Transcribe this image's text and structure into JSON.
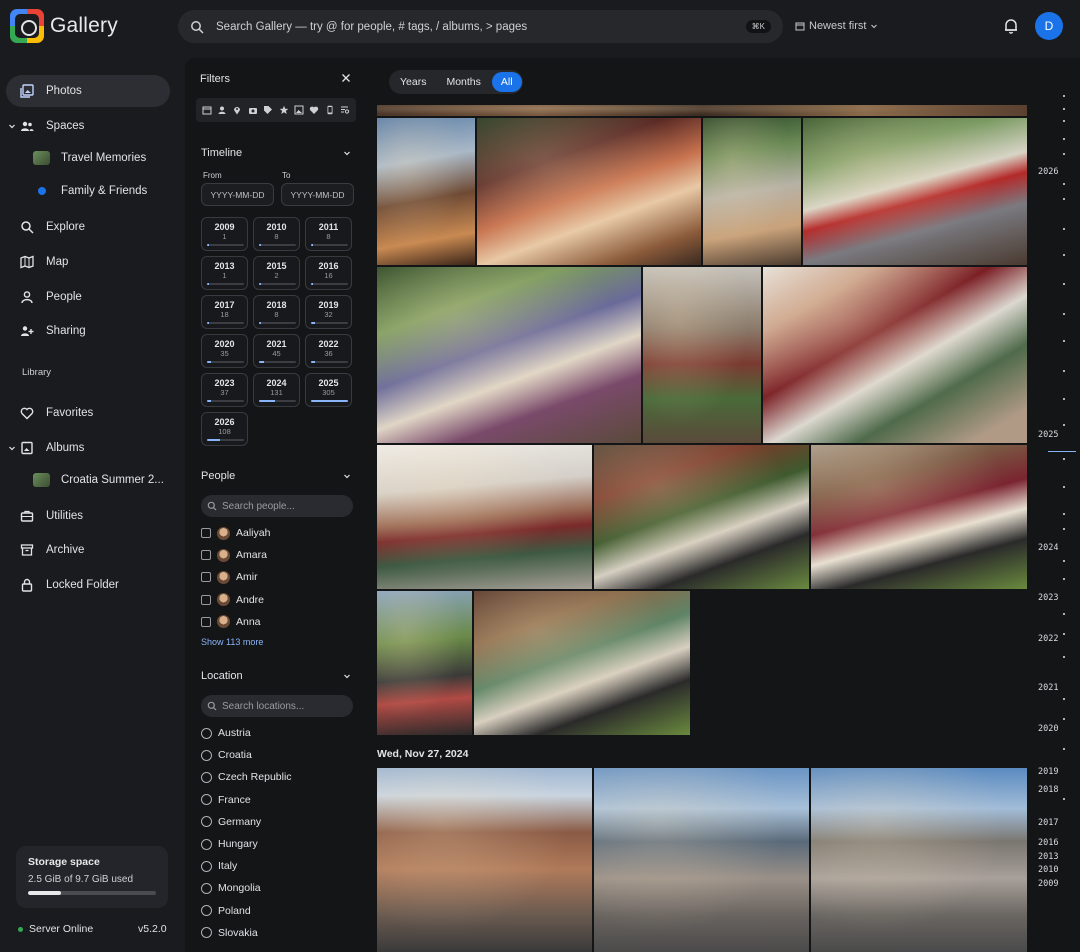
{
  "app": {
    "name": "Gallery"
  },
  "header": {
    "search_placeholder": "Search Gallery — try @ for people, # tags, / albums, > pages",
    "search_shortcut": "⌘K",
    "sort_label": "Newest first",
    "avatar_letter": "D"
  },
  "sidebar": {
    "items": [
      {
        "label": "Photos",
        "icon": "photos-icon",
        "active": true
      },
      {
        "label": "Spaces",
        "icon": "people-group-icon"
      },
      {
        "label": "Travel Memories",
        "icon": "thumbnail"
      },
      {
        "label": "Family & Friends",
        "icon": "blue-dot"
      },
      {
        "label": "Explore",
        "icon": "search-icon"
      },
      {
        "label": "Map",
        "icon": "map-icon"
      },
      {
        "label": "People",
        "icon": "person-icon"
      },
      {
        "label": "Sharing",
        "icon": "sharing-icon"
      },
      {
        "label": "Favorites",
        "icon": "heart-icon"
      },
      {
        "label": "Albums",
        "icon": "album-icon"
      },
      {
        "label": "Croatia Summer 2...",
        "icon": "thumbnail"
      },
      {
        "label": "Utilities",
        "icon": "utilities-icon"
      },
      {
        "label": "Archive",
        "icon": "archive-icon"
      },
      {
        "label": "Locked Folder",
        "icon": "lock-icon"
      }
    ],
    "library_label": "Library",
    "storage": {
      "title": "Storage space",
      "text": "2.5 GiB of 9.7 GiB used",
      "fraction": 0.26
    },
    "server_status": "Server Online",
    "version": "v5.2.0"
  },
  "filters": {
    "title": "Filters",
    "timeline": {
      "title": "Timeline",
      "from_label": "From",
      "to_label": "To",
      "from_placeholder": "YYYY-MM-DD",
      "to_placeholder": "YYYY-MM-DD",
      "years": [
        {
          "year": "2009",
          "count": "1"
        },
        {
          "year": "2010",
          "count": "8"
        },
        {
          "year": "2011",
          "count": "8"
        },
        {
          "year": "2013",
          "count": "1"
        },
        {
          "year": "2015",
          "count": "2"
        },
        {
          "year": "2016",
          "count": "16"
        },
        {
          "year": "2017",
          "count": "18"
        },
        {
          "year": "2018",
          "count": "8"
        },
        {
          "year": "2019",
          "count": "32"
        },
        {
          "year": "2020",
          "count": "35"
        },
        {
          "year": "2021",
          "count": "45"
        },
        {
          "year": "2022",
          "count": "36"
        },
        {
          "year": "2023",
          "count": "37"
        },
        {
          "year": "2024",
          "count": "131"
        },
        {
          "year": "2025",
          "count": "305"
        },
        {
          "year": "2026",
          "count": "108"
        }
      ]
    },
    "people": {
      "title": "People",
      "search_placeholder": "Search people...",
      "items": [
        "Aaliyah",
        "Amara",
        "Amir",
        "Andre",
        "Anna"
      ],
      "show_more": "Show 113 more"
    },
    "location": {
      "title": "Location",
      "search_placeholder": "Search locations...",
      "items": [
        "Austria",
        "Croatia",
        "Czech Republic",
        "France",
        "Germany",
        "Hungary",
        "Italy",
        "Mongolia",
        "Poland",
        "Slovakia"
      ]
    }
  },
  "main": {
    "view_tabs": [
      "Years",
      "Months",
      "All"
    ],
    "active_tab": "All",
    "date_group": "Wed, Nov 27, 2024"
  },
  "timeline_scrubber": {
    "years": [
      "2026",
      "2025",
      "2024",
      "2023",
      "2022",
      "2021",
      "2020",
      "2019",
      "2018",
      "2017",
      "2016",
      "2013",
      "2010",
      "2009"
    ]
  }
}
